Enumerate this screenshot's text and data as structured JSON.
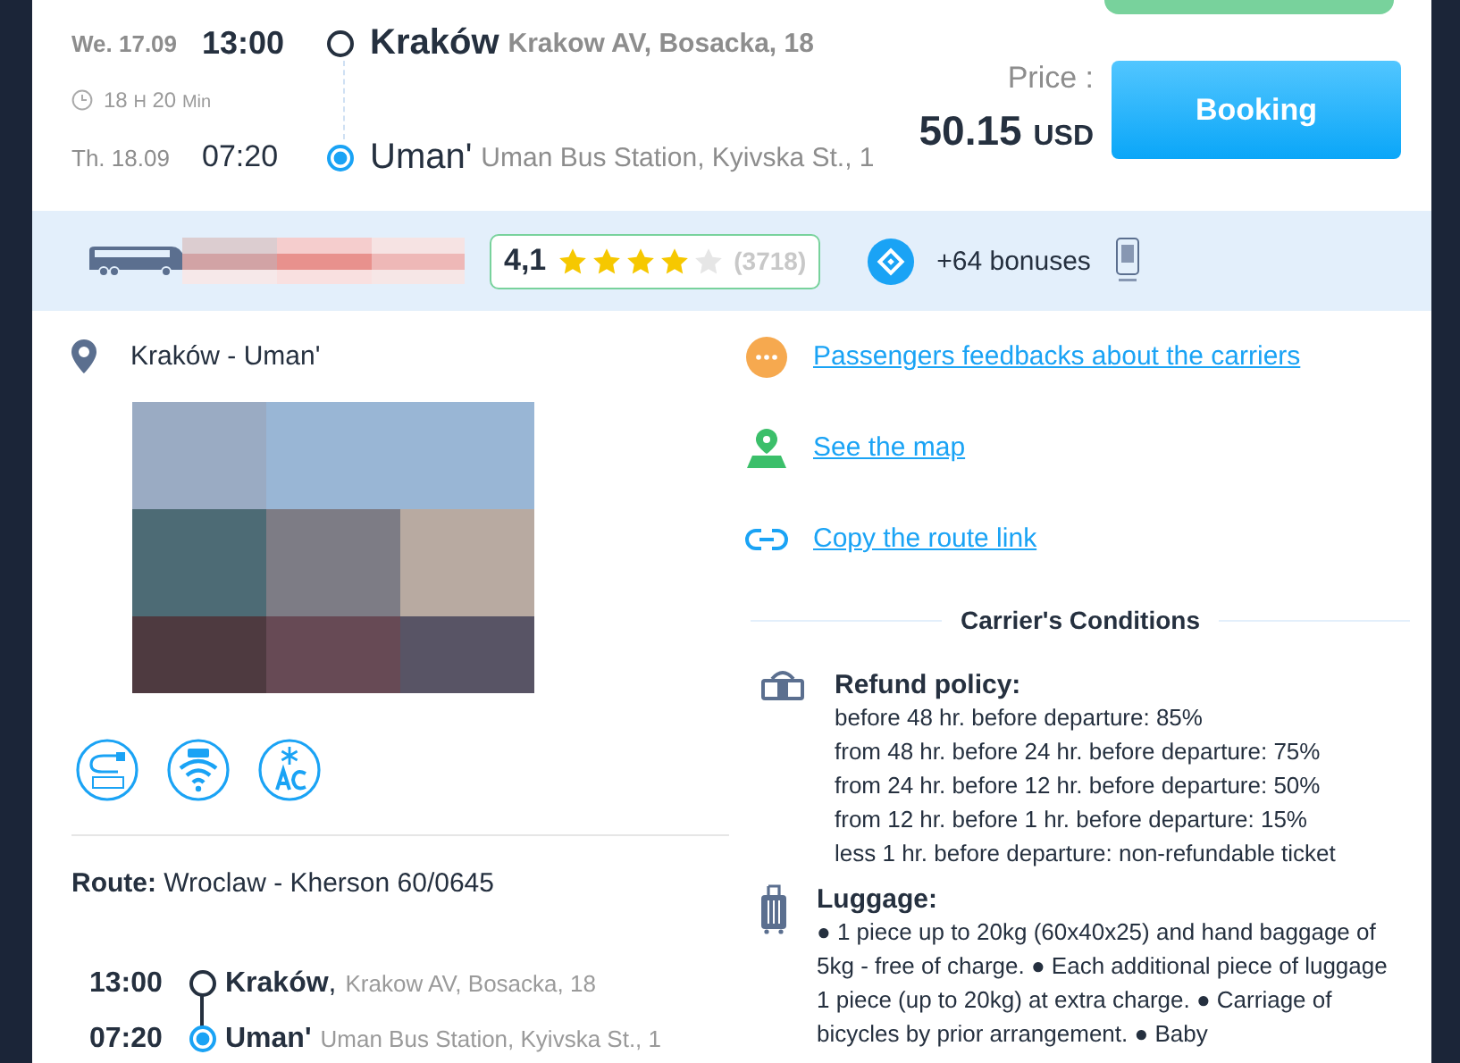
{
  "badge": {
    "kind": "recommended"
  },
  "trip": {
    "departure": {
      "day": "We. 17.09",
      "time": "13:00",
      "city": "Kraków",
      "address": "Krakow AV, Bosacka, 18"
    },
    "duration": {
      "hours": "18",
      "h_unit": "H",
      "minutes": "20",
      "m_unit": "Min"
    },
    "arrival": {
      "day": "Th. 18.09",
      "time": "07:20",
      "city": "Uman'",
      "address": "Uman Bus Station, Kyivska St., 1"
    }
  },
  "price": {
    "label": "Price :",
    "amount": "50.15",
    "currency": "USD"
  },
  "booking_button": "Booking",
  "carrier_bar": {
    "rating": "4,1",
    "stars": 4,
    "reviews": "(3718)",
    "bonuses": "+64 bonuses"
  },
  "route_name": "Kraków - Uman'",
  "amenities": [
    {
      "kind": "socket"
    },
    {
      "kind": "wifi"
    },
    {
      "kind": "ac"
    }
  ],
  "route": {
    "label": "Route:",
    "value": "Wroclaw - Kherson 60/0645"
  },
  "stops": [
    {
      "time": "13:00",
      "city": "Kraków",
      "separator": ",",
      "address": "Krakow AV, Bosacka, 18",
      "selected": false
    },
    {
      "time": "07:20",
      "city": "Uman'",
      "address": "Uman Bus Station, Kyivska St., 1",
      "selected": true
    }
  ],
  "links": [
    {
      "kind": "chat",
      "label": "Passengers feedbacks about the carriers"
    },
    {
      "kind": "map",
      "label": "See the map"
    },
    {
      "kind": "link",
      "label": "Copy the route link"
    }
  ],
  "conditions": {
    "title": "Carrier's Conditions",
    "items": [
      {
        "kind": "refund",
        "title": "Refund policy:",
        "lines": [
          "before 48 hr. before departure: 85%",
          "from 48 hr. before 24 hr. before departure: 75%",
          "from 24 hr. before 12 hr. before departure: 50%",
          "from 12 hr. before 1 hr. before departure: 15%",
          "less 1 hr. before departure: non-refundable ticket"
        ]
      },
      {
        "kind": "luggage",
        "title": "Luggage:",
        "lines": [
          "● 1 piece up to 20kg (60x40x25) and hand baggage of 5kg - free of charge. ● Each additional piece of luggage 1 piece (up to 20kg) at extra charge. ● Carriage of bicycles by prior arrangement. ● Baby"
        ]
      }
    ]
  }
}
